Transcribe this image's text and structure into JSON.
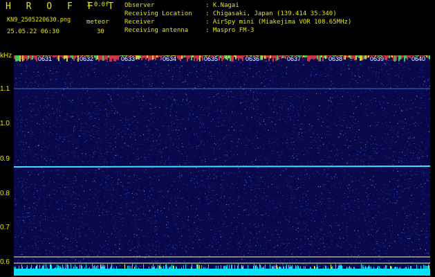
{
  "header": {
    "brand": "H R O F F T",
    "version": "1.0.0f",
    "filename": "KN9_2505220630.png",
    "meteor_label": "meteor",
    "datetime": "25.05.22 06:30",
    "meteor_count": "30",
    "info": [
      {
        "label": "Observer",
        "value": ": K.Nagai"
      },
      {
        "label": "Receiving Location",
        "value": ": Chigasaki, Japan (139.414 35.340)"
      },
      {
        "label": "Receiver",
        "value": ": AirSpy mini (Miakejima VOR 108.65MHz)"
      },
      {
        "label": "Receiving antenna",
        "value": ": Maspro FM-3"
      }
    ]
  },
  "axis": {
    "y_unit": "kHz",
    "y_ticks": [
      "1.1",
      "1.0",
      "0.9",
      "0.8",
      "0.7",
      "0.6"
    ],
    "time_ticks": [
      "0631",
      "0632",
      "0633",
      "0634",
      "0635",
      "0636",
      "0637",
      "0638",
      "0639",
      "0640"
    ]
  },
  "colors": {
    "text": "#e6e600",
    "background": "#08084a",
    "signal_line": "#44ddff",
    "bottom_band": "#00e5ff"
  }
}
